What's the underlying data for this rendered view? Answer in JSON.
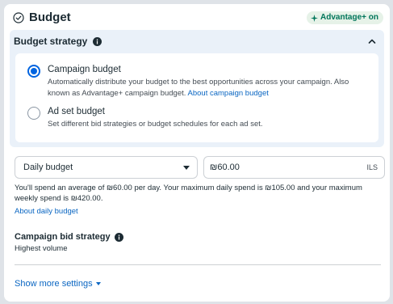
{
  "header": {
    "title": "Budget",
    "badge": "Advantage+ on"
  },
  "budget_strategy": {
    "title": "Budget strategy",
    "options": [
      {
        "title": "Campaign budget",
        "desc_line1": "Automatically distribute your budget to the best opportunities across your campaign. Also",
        "desc_line2_prefix": "known as Advantage+ campaign budget. ",
        "link": "About campaign budget",
        "selected": true
      },
      {
        "title": "Ad set budget",
        "desc": "Set different bid strategies or budget schedules for each ad set.",
        "selected": false
      }
    ]
  },
  "budget_type": {
    "selected": "Daily budget"
  },
  "amount": {
    "value": "₪60.00",
    "currency": "ILS"
  },
  "spend_info": {
    "text": "You'll spend an average of ₪60.00 per day. Your maximum daily spend is ₪105.00 and your maximum weekly spend is ₪420.00.",
    "link": "About daily budget"
  },
  "bid_strategy": {
    "title": "Campaign bid strategy",
    "value": "Highest volume"
  },
  "footer": {
    "show_more": "Show more settings"
  },
  "colors": {
    "accent": "#0064e0",
    "link": "#0a66c2",
    "panel_bg": "#eaf1f9",
    "badge_bg": "#e6f2e8",
    "badge_text": "#00755a"
  }
}
